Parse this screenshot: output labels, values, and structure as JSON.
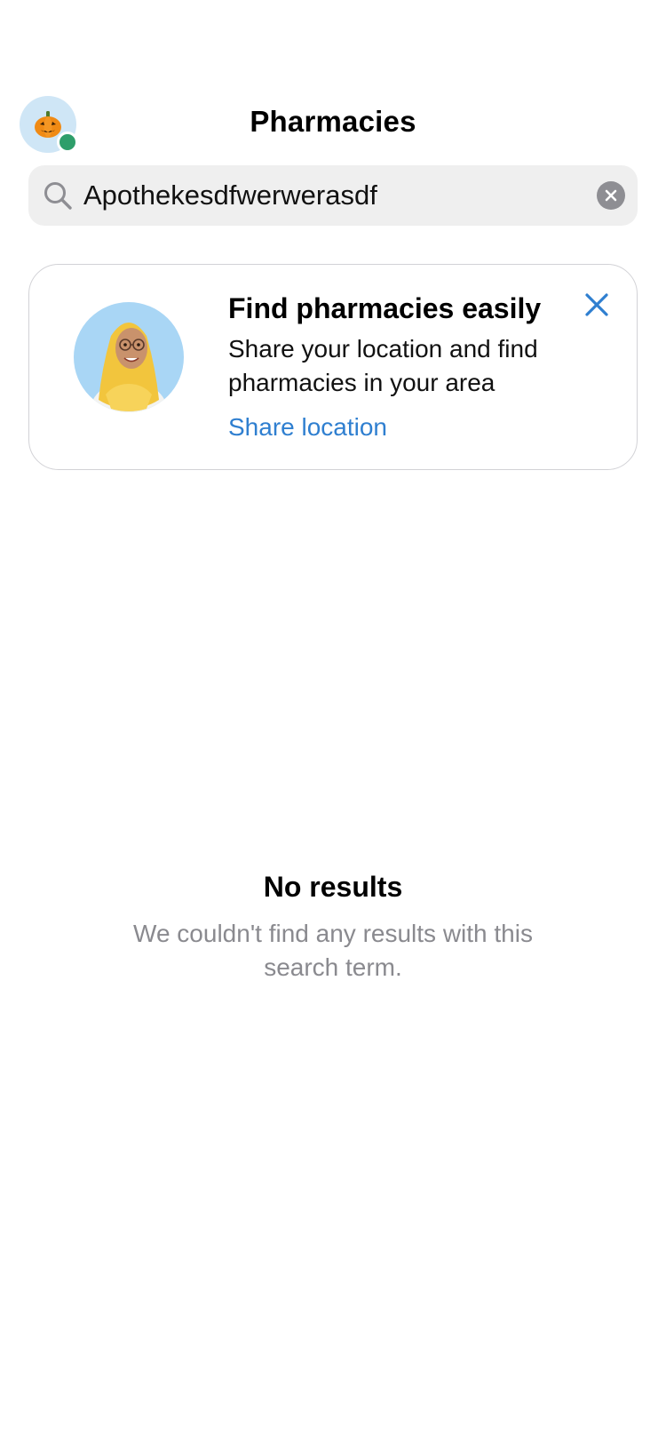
{
  "header": {
    "title": "Pharmacies",
    "avatar_emoji": "🎃",
    "status_color": "#2e9e6a"
  },
  "search": {
    "value": "Apothekesdfwerwerasdf",
    "placeholder": "Search"
  },
  "location_card": {
    "title": "Find pharmacies easily",
    "body": "Share your location and find pharmacies in your area",
    "link_label": "Share location",
    "link_color": "#2f7fd0",
    "illustration": "pharmacist-avatar",
    "close_icon": "close-icon"
  },
  "empty_state": {
    "title": "No results",
    "subtitle": "We couldn't find any results with this search term."
  }
}
